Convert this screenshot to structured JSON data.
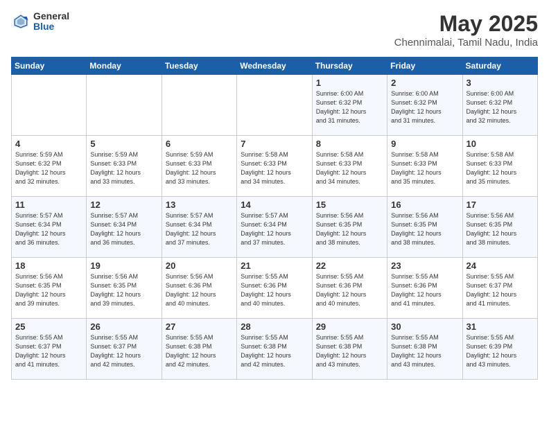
{
  "header": {
    "logo_general": "General",
    "logo_blue": "Blue",
    "title": "May 2025",
    "subtitle": "Chennimalai, Tamil Nadu, India"
  },
  "days_of_week": [
    "Sunday",
    "Monday",
    "Tuesday",
    "Wednesday",
    "Thursday",
    "Friday",
    "Saturday"
  ],
  "weeks": [
    [
      {
        "num": "",
        "info": ""
      },
      {
        "num": "",
        "info": ""
      },
      {
        "num": "",
        "info": ""
      },
      {
        "num": "",
        "info": ""
      },
      {
        "num": "1",
        "info": "Sunrise: 6:00 AM\nSunset: 6:32 PM\nDaylight: 12 hours\nand 31 minutes."
      },
      {
        "num": "2",
        "info": "Sunrise: 6:00 AM\nSunset: 6:32 PM\nDaylight: 12 hours\nand 31 minutes."
      },
      {
        "num": "3",
        "info": "Sunrise: 6:00 AM\nSunset: 6:32 PM\nDaylight: 12 hours\nand 32 minutes."
      }
    ],
    [
      {
        "num": "4",
        "info": "Sunrise: 5:59 AM\nSunset: 6:32 PM\nDaylight: 12 hours\nand 32 minutes."
      },
      {
        "num": "5",
        "info": "Sunrise: 5:59 AM\nSunset: 6:33 PM\nDaylight: 12 hours\nand 33 minutes."
      },
      {
        "num": "6",
        "info": "Sunrise: 5:59 AM\nSunset: 6:33 PM\nDaylight: 12 hours\nand 33 minutes."
      },
      {
        "num": "7",
        "info": "Sunrise: 5:58 AM\nSunset: 6:33 PM\nDaylight: 12 hours\nand 34 minutes."
      },
      {
        "num": "8",
        "info": "Sunrise: 5:58 AM\nSunset: 6:33 PM\nDaylight: 12 hours\nand 34 minutes."
      },
      {
        "num": "9",
        "info": "Sunrise: 5:58 AM\nSunset: 6:33 PM\nDaylight: 12 hours\nand 35 minutes."
      },
      {
        "num": "10",
        "info": "Sunrise: 5:58 AM\nSunset: 6:33 PM\nDaylight: 12 hours\nand 35 minutes."
      }
    ],
    [
      {
        "num": "11",
        "info": "Sunrise: 5:57 AM\nSunset: 6:34 PM\nDaylight: 12 hours\nand 36 minutes."
      },
      {
        "num": "12",
        "info": "Sunrise: 5:57 AM\nSunset: 6:34 PM\nDaylight: 12 hours\nand 36 minutes."
      },
      {
        "num": "13",
        "info": "Sunrise: 5:57 AM\nSunset: 6:34 PM\nDaylight: 12 hours\nand 37 minutes."
      },
      {
        "num": "14",
        "info": "Sunrise: 5:57 AM\nSunset: 6:34 PM\nDaylight: 12 hours\nand 37 minutes."
      },
      {
        "num": "15",
        "info": "Sunrise: 5:56 AM\nSunset: 6:35 PM\nDaylight: 12 hours\nand 38 minutes."
      },
      {
        "num": "16",
        "info": "Sunrise: 5:56 AM\nSunset: 6:35 PM\nDaylight: 12 hours\nand 38 minutes."
      },
      {
        "num": "17",
        "info": "Sunrise: 5:56 AM\nSunset: 6:35 PM\nDaylight: 12 hours\nand 38 minutes."
      }
    ],
    [
      {
        "num": "18",
        "info": "Sunrise: 5:56 AM\nSunset: 6:35 PM\nDaylight: 12 hours\nand 39 minutes."
      },
      {
        "num": "19",
        "info": "Sunrise: 5:56 AM\nSunset: 6:35 PM\nDaylight: 12 hours\nand 39 minutes."
      },
      {
        "num": "20",
        "info": "Sunrise: 5:56 AM\nSunset: 6:36 PM\nDaylight: 12 hours\nand 40 minutes."
      },
      {
        "num": "21",
        "info": "Sunrise: 5:55 AM\nSunset: 6:36 PM\nDaylight: 12 hours\nand 40 minutes."
      },
      {
        "num": "22",
        "info": "Sunrise: 5:55 AM\nSunset: 6:36 PM\nDaylight: 12 hours\nand 40 minutes."
      },
      {
        "num": "23",
        "info": "Sunrise: 5:55 AM\nSunset: 6:36 PM\nDaylight: 12 hours\nand 41 minutes."
      },
      {
        "num": "24",
        "info": "Sunrise: 5:55 AM\nSunset: 6:37 PM\nDaylight: 12 hours\nand 41 minutes."
      }
    ],
    [
      {
        "num": "25",
        "info": "Sunrise: 5:55 AM\nSunset: 6:37 PM\nDaylight: 12 hours\nand 41 minutes."
      },
      {
        "num": "26",
        "info": "Sunrise: 5:55 AM\nSunset: 6:37 PM\nDaylight: 12 hours\nand 42 minutes."
      },
      {
        "num": "27",
        "info": "Sunrise: 5:55 AM\nSunset: 6:38 PM\nDaylight: 12 hours\nand 42 minutes."
      },
      {
        "num": "28",
        "info": "Sunrise: 5:55 AM\nSunset: 6:38 PM\nDaylight: 12 hours\nand 42 minutes."
      },
      {
        "num": "29",
        "info": "Sunrise: 5:55 AM\nSunset: 6:38 PM\nDaylight: 12 hours\nand 43 minutes."
      },
      {
        "num": "30",
        "info": "Sunrise: 5:55 AM\nSunset: 6:38 PM\nDaylight: 12 hours\nand 43 minutes."
      },
      {
        "num": "31",
        "info": "Sunrise: 5:55 AM\nSunset: 6:39 PM\nDaylight: 12 hours\nand 43 minutes."
      }
    ]
  ]
}
